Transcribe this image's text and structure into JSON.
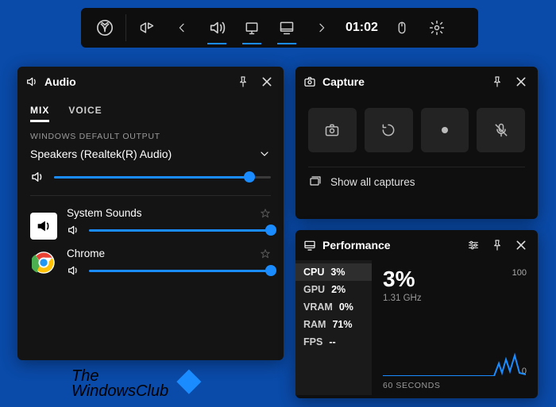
{
  "toolbar": {
    "time": "01:02"
  },
  "audio": {
    "title": "Audio",
    "tabs": {
      "mix": "MIX",
      "voice": "VOICE"
    },
    "output_section_label": "WINDOWS DEFAULT OUTPUT",
    "device": "Speakers (Realtek(R) Audio)",
    "master_value": 90,
    "apps": [
      {
        "name": "System Sounds",
        "value": 100,
        "icon": "speaker"
      },
      {
        "name": "Chrome",
        "value": 100,
        "icon": "chrome"
      }
    ]
  },
  "capture": {
    "title": "Capture",
    "show_all": "Show all captures"
  },
  "performance": {
    "title": "Performance",
    "rows": [
      {
        "label": "CPU",
        "value": "3%"
      },
      {
        "label": "GPU",
        "value": "2%"
      },
      {
        "label": "VRAM",
        "value": "0%"
      },
      {
        "label": "RAM",
        "value": "71%"
      },
      {
        "label": "FPS",
        "value": "--"
      }
    ],
    "big": "3%",
    "freq": "1.31 GHz",
    "axis_high": "100",
    "axis_low": "0",
    "time_axis": "60 SECONDS"
  },
  "watermark": {
    "line1": "The",
    "line2": "WindowsClub"
  }
}
